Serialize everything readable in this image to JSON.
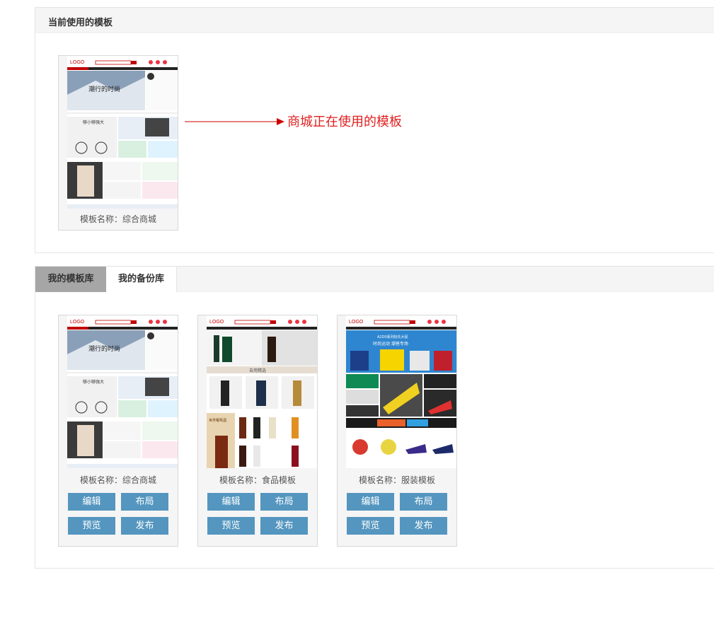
{
  "current_section": {
    "title": "当前使用的模板",
    "template_name": "模板名称：综合商城",
    "annotation": "商城正在使用的模板"
  },
  "library_section": {
    "tabs": [
      {
        "label": "我的模板库",
        "active": true
      },
      {
        "label": "我的备份库",
        "active": false
      }
    ],
    "templates": [
      {
        "name": "模板名称：综合商城",
        "thumb": "mall"
      },
      {
        "name": "模板名称：食品模板",
        "thumb": "food"
      },
      {
        "name": "模板名称：服装模板",
        "thumb": "sports"
      }
    ],
    "buttons": {
      "edit": "编辑",
      "layout": "布局",
      "preview": "预览",
      "publish": "发布"
    }
  },
  "thumb_text": {
    "logo": "LOGO",
    "mall_banner": "潮行的时尚",
    "mall_bike": "够小够强大",
    "food_header": "自用精选",
    "food_wine": "世界葡萄酒",
    "sports_banner_1": "A2D0系列抢先大促",
    "sports_banner_2": "时尚运动 潮爸专场"
  },
  "colors": {
    "accent": "#5496bf",
    "annotation": "#e02020",
    "logo": "#c00000"
  }
}
